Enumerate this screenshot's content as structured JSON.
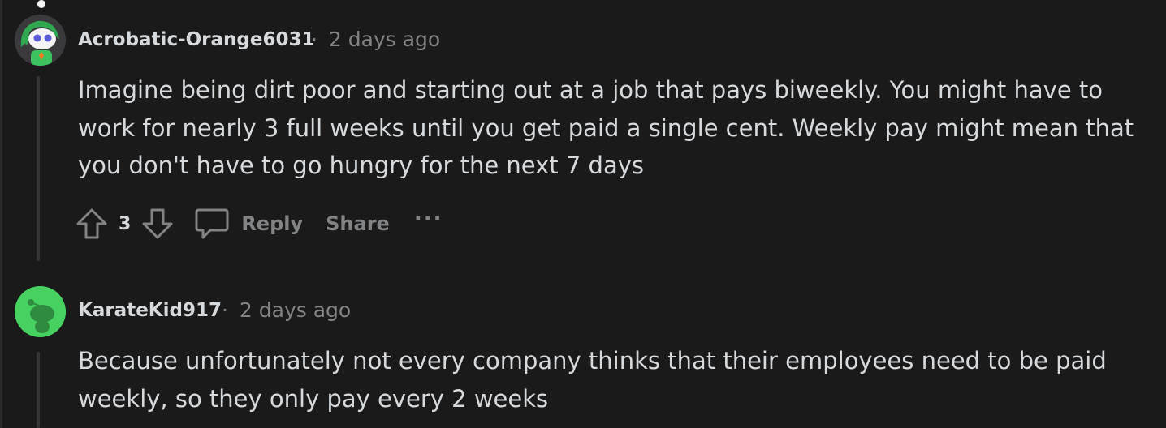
{
  "comments": [
    {
      "username": "Acrobatic-Orange6031",
      "separator": "·",
      "timestamp": "2 days ago",
      "body": "Imagine being dirt poor and starting out at a job that pays biweekly. You might have to work for nearly 3 full weeks until you get paid a single cent. Weekly pay might mean that you don't have to go hungry for the next 7 days",
      "score": "3",
      "reply_label": "Reply",
      "share_label": "Share",
      "more_label": "···",
      "avatar_icon": "snoo-avatar-green-hair-icon"
    },
    {
      "username": "KarateKid917",
      "separator": "·",
      "timestamp": "2 days ago",
      "body": "Because unfortunately not every company thinks that their employees need to be paid weekly, so they only pay every 2 weeks",
      "avatar_icon": "snoo-default-green-icon"
    }
  ],
  "colors": {
    "background": "#1a1a1b",
    "text": "#d7dadc",
    "muted": "#818384",
    "thread_line": "#343536",
    "avatar_green": "#46d160"
  }
}
